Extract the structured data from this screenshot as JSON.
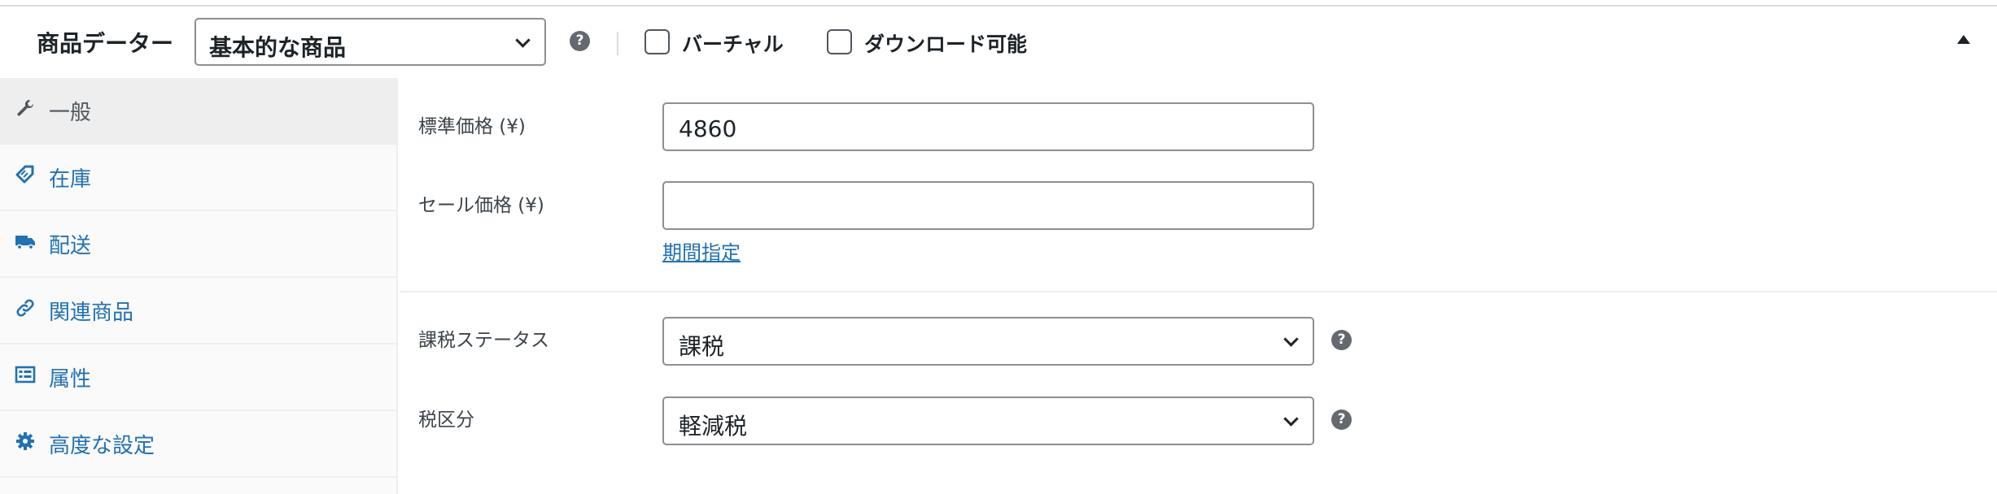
{
  "header": {
    "title": "商品データー",
    "product_type": "基本的な商品",
    "help_icon": "question-circle-icon",
    "virtual_label": "バーチャル",
    "downloadable_label": "ダウンロード可能",
    "virtual_checked": false,
    "downloadable_checked": false
  },
  "tabs": [
    {
      "label": "一般",
      "icon": "wrench-icon",
      "active": true
    },
    {
      "label": "在庫",
      "icon": "tag-icon",
      "active": false
    },
    {
      "label": "配送",
      "icon": "truck-icon",
      "active": false
    },
    {
      "label": "関連商品",
      "icon": "link-icon",
      "active": false
    },
    {
      "label": "属性",
      "icon": "list-table-icon",
      "active": false
    },
    {
      "label": "高度な設定",
      "icon": "gear-icon",
      "active": false
    }
  ],
  "pricing": {
    "regular_label": "標準価格 (¥)",
    "regular_value": "4860",
    "sale_label": "セール価格 (¥)",
    "sale_value": "",
    "schedule_link": "期間指定"
  },
  "tax": {
    "status_label": "課税ステータス",
    "status_value": "課税",
    "class_label": "税区分",
    "class_value": "軽減税"
  },
  "colors": {
    "link": "#2271b1",
    "text": "#1d2327",
    "sidebar_bg": "#fafafa",
    "active_tab_bg": "#eeeeee"
  }
}
